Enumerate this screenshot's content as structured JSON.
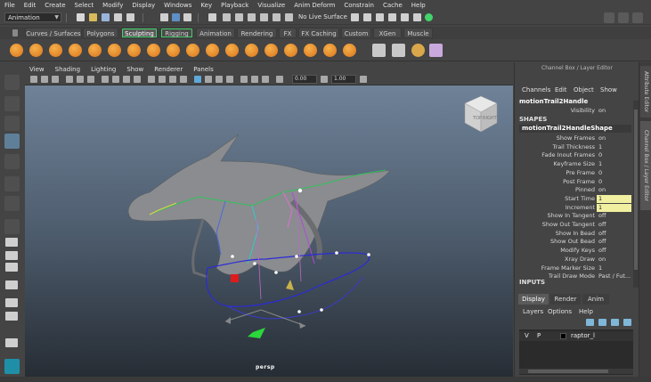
{
  "menubar": [
    "File",
    "Edit",
    "Create",
    "Select",
    "Modify",
    "Display",
    "Windows",
    "Key",
    "Playback",
    "Visualize",
    "Anim Deform",
    "Constrain",
    "Cache",
    "Help"
  ],
  "statusline": {
    "mode": "Animation",
    "live_surface": "No Live Surface"
  },
  "shelf_tabs": [
    {
      "label": "Curves / Surfaces",
      "active": false
    },
    {
      "label": "Polygons",
      "active": false
    },
    {
      "label": "Sculpting",
      "active": true
    },
    {
      "label": "Rigging",
      "active": false
    },
    {
      "label": "Animation",
      "active": false
    },
    {
      "label": "Rendering",
      "active": false
    },
    {
      "label": "FX",
      "active": false
    },
    {
      "label": "FX Caching",
      "active": false
    },
    {
      "label": "Custom",
      "active": false
    },
    {
      "label": "XGen",
      "active": false
    },
    {
      "label": "Muscle",
      "active": false
    }
  ],
  "viewport": {
    "menu": [
      "View",
      "Shading",
      "Lighting",
      "Show",
      "Renderer",
      "Panels"
    ],
    "camera": "persp",
    "field_values": [
      "0.00",
      "1.00"
    ],
    "viewcube_faces": [
      "TOP",
      "RIGHT"
    ]
  },
  "channel_box": {
    "title": "Channel Box / Layer Editor",
    "menu": [
      "Channels",
      "Edit",
      "Object",
      "Show"
    ],
    "node": "motionTrail2Handle",
    "visibility": {
      "label": "Visibility",
      "value": "on"
    },
    "shapes_header": "SHAPES",
    "shape_node": "motionTrail2HandleShape",
    "attributes": [
      {
        "label": "Show Frames",
        "value": "on",
        "highlight": false
      },
      {
        "label": "Trail Thickness",
        "value": "1",
        "highlight": false
      },
      {
        "label": "Fade Inout Frames",
        "value": "0",
        "highlight": false
      },
      {
        "label": "Keyframe Size",
        "value": "1",
        "highlight": false
      },
      {
        "label": "Pre Frame",
        "value": "0",
        "highlight": false
      },
      {
        "label": "Post Frame",
        "value": "0",
        "highlight": false
      },
      {
        "label": "Pinned",
        "value": "on",
        "highlight": false
      },
      {
        "label": "Start Time",
        "value": "1",
        "highlight": true
      },
      {
        "label": "Increment",
        "value": "1",
        "highlight": true
      },
      {
        "label": "Show In Tangent",
        "value": "off",
        "highlight": false
      },
      {
        "label": "Show Out Tangent",
        "value": "off",
        "highlight": false
      },
      {
        "label": "Show In Bead",
        "value": "off",
        "highlight": false
      },
      {
        "label": "Show Out Bead",
        "value": "off",
        "highlight": false
      },
      {
        "label": "Modify Keys",
        "value": "off",
        "highlight": false
      },
      {
        "label": "Xray Draw",
        "value": "on",
        "highlight": false
      },
      {
        "label": "Frame Marker Size",
        "value": "1",
        "highlight": false
      },
      {
        "label": "Trail Draw Mode",
        "value": "Past / Fut...",
        "highlight": false
      }
    ],
    "inputs_header": "INPUTS"
  },
  "layer_editor": {
    "tabs": [
      {
        "label": "Display",
        "active": true
      },
      {
        "label": "Render",
        "active": false
      },
      {
        "label": "Anim",
        "active": false
      }
    ],
    "menu": [
      "Layers",
      "Options",
      "Help"
    ],
    "layers": [
      {
        "v": "V",
        "p": "P",
        "name": "raptor_l"
      }
    ]
  },
  "side_tabs": [
    "Attribute Editor",
    "Channel Box / Layer Editor"
  ],
  "colors": {
    "accent_green": "#43d36b",
    "highlight_field": "#f0f0a0",
    "trail_blue": "#2c2ad8"
  }
}
